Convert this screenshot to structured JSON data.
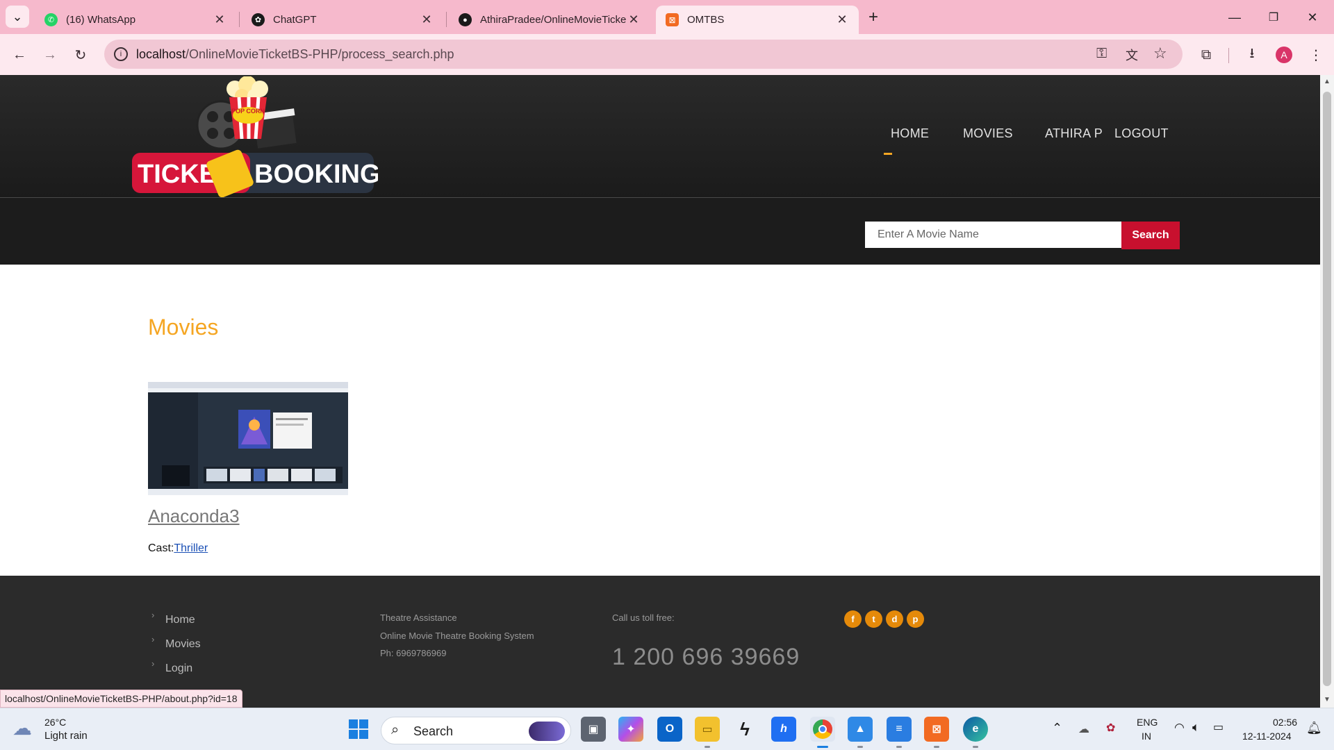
{
  "browser": {
    "tabs": [
      {
        "title": "(16) WhatsApp",
        "icon": "whatsapp-icon",
        "color": "#25d366"
      },
      {
        "title": "ChatGPT",
        "icon": "chatgpt-icon",
        "color": "#1a1a1a"
      },
      {
        "title": "AthiraPradee/OnlineMovieTicke",
        "icon": "github-icon",
        "color": "#1a1a1a"
      },
      {
        "title": "OMTBS",
        "icon": "xampp-icon",
        "color": "#f26a22",
        "active": true
      }
    ],
    "url_host": "localhost",
    "url_path": "/OnlineMovieTicketBS-PHP/process_search.php",
    "profile_initial": "A"
  },
  "site": {
    "logo_text_left": "TICKET",
    "logo_text_right": "BOOKING",
    "logo_badge": "POP CORN",
    "nav": [
      "HOME",
      "MOVIES",
      "ATHIRA P",
      "LOGOUT"
    ],
    "search_placeholder": "Enter A Movie Name",
    "search_button": "Search",
    "section_title": "Movies",
    "movie": {
      "name": "Anaconda3",
      "cast_label": "Cast:",
      "cast_value": "Thriller"
    },
    "footer": {
      "links": [
        "Home",
        "Movies",
        "Login"
      ],
      "assist_title": "Theatre Assistance",
      "assist_line": "Online Movie Theatre Booking System",
      "assist_phone": "Ph: 6969786969",
      "toll_label": "Call us toll free:",
      "toll_number": "1 200 696 39669",
      "social": [
        "f",
        "t",
        "d",
        "p"
      ]
    },
    "status_url": "localhost/OnlineMovieTicketBS-PHP/about.php?id=18"
  },
  "taskbar": {
    "weather_temp": "26°C",
    "weather_desc": "Light rain",
    "search_label": "Search",
    "lang_top": "ENG",
    "lang_bottom": "IN",
    "time": "02:56",
    "date": "12-11-2024"
  },
  "colors": {
    "accent": "#f5a623",
    "search_button": "#c8102e",
    "link": "#1a4fb5",
    "tabbar": "#f6b9cc"
  }
}
